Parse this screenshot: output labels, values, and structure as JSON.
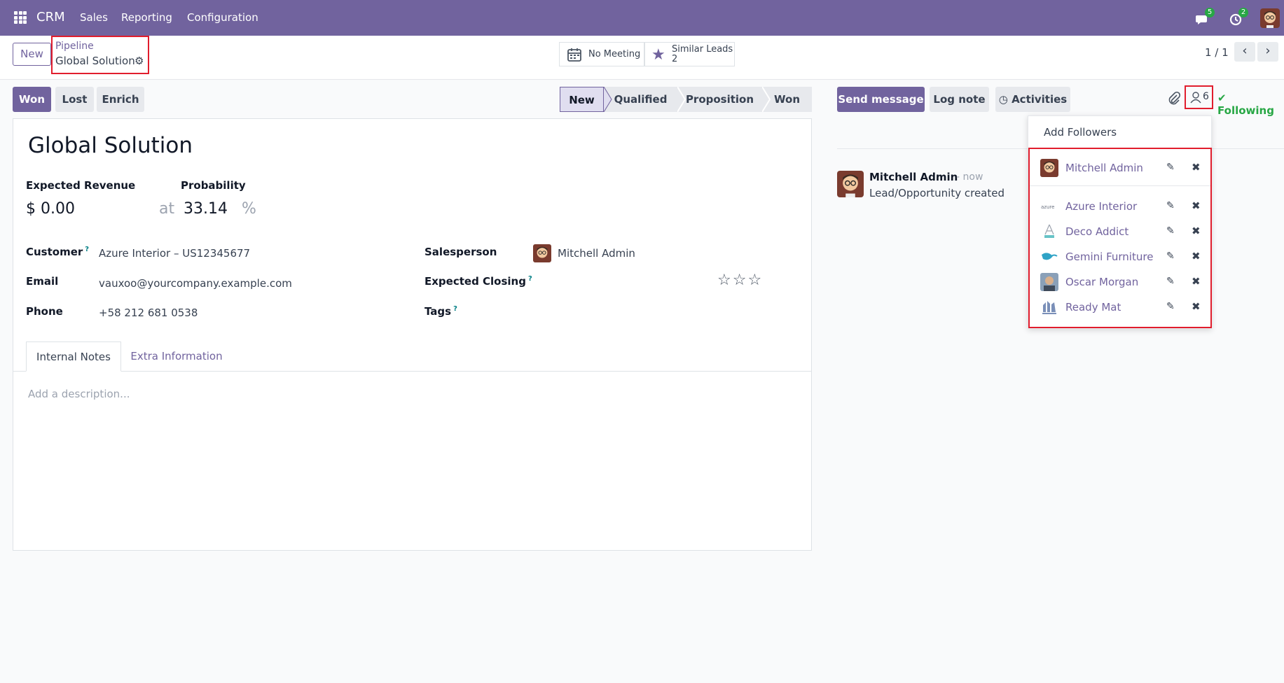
{
  "navbar": {
    "app_name": "CRM",
    "menus": [
      "Sales",
      "Reporting",
      "Configuration"
    ],
    "messages_count": "5",
    "activities_count": "2"
  },
  "control": {
    "new_label": "New",
    "breadcrumb_parent": "Pipeline",
    "breadcrumb_current": "Global Solution",
    "smart_meeting": "No Meeting",
    "smart_similar_label": "Similar Leads",
    "smart_similar_count": "2",
    "pager": "1 / 1"
  },
  "statusbar": {
    "won": "Won",
    "lost": "Lost",
    "enrich": "Enrich",
    "stages": [
      "New",
      "Qualified",
      "Proposition",
      "Won"
    ],
    "active_stage": "New"
  },
  "form": {
    "title": "Global Solution",
    "expected_revenue_label": "Expected Revenue",
    "expected_revenue": "$ 0.00",
    "at": "at",
    "probability_label": "Probability",
    "probability": "33.14",
    "percent": "%",
    "customer_label": "Customer",
    "customer": "Azure Interior – US12345677",
    "email_label": "Email",
    "email": "vauxoo@yourcompany.example.com",
    "phone_label": "Phone",
    "phone": "+58 212 681 0538",
    "salesperson_label": "Salesperson",
    "salesperson": "Mitchell Admin",
    "expected_closing_label": "Expected Closing",
    "tags_label": "Tags",
    "help_mark": "?",
    "tabs": [
      "Internal Notes",
      "Extra Information"
    ],
    "description_placeholder": "Add a description..."
  },
  "chatter": {
    "send_message": "Send message",
    "log_note": "Log note",
    "activities": "Activities",
    "followers_count": "6",
    "following": "Following",
    "message_author": "Mitchell Admin",
    "message_time": "- now",
    "message_body": "Lead/Opportunity created"
  },
  "followers_dropdown": {
    "add_followers": "Add Followers",
    "followers": [
      "Mitchell Admin",
      "Azure Interior",
      "Deco Addict",
      "Gemini Furniture",
      "Oscar Morgan",
      "Ready Mat"
    ]
  },
  "colors": {
    "brand": "#71639e",
    "highlight": "#e11d2d",
    "following": "#28a745"
  }
}
